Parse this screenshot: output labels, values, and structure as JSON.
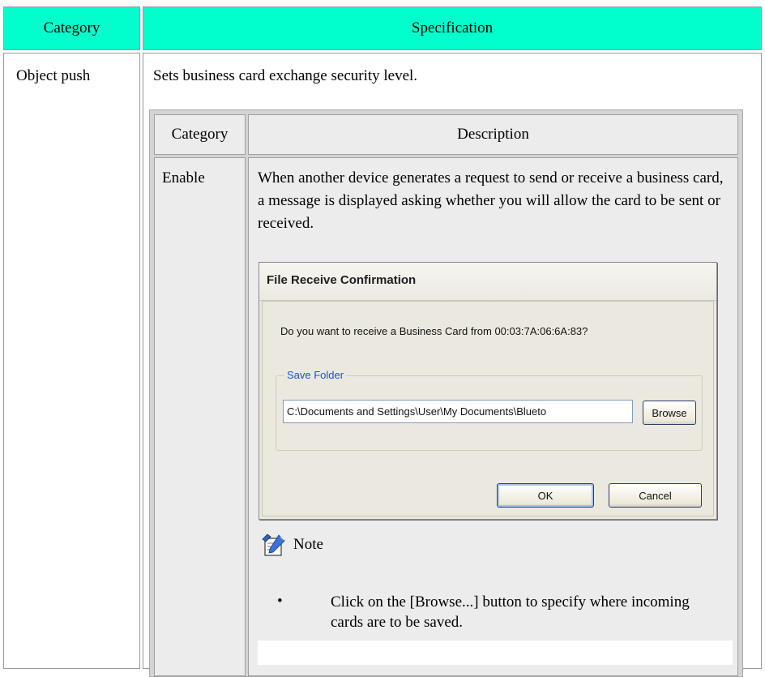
{
  "outer_table": {
    "header_category": "Category",
    "header_specification": "Specification",
    "row_category": "Object push",
    "row_intro": "Sets business card exchange security level."
  },
  "inner_table": {
    "header_category": "Category",
    "header_description": "Description",
    "row_category": "Enable",
    "row_description": "When another device generates a request to send or receive a business card, a message is displayed asking whether you will allow the card to be sent or received."
  },
  "dialog": {
    "title": "File Receive Confirmation",
    "question": "Do you want to receive a Business Card from 00:03:7A:06:6A:83?",
    "group_label": "Save Folder",
    "path_value": "C:\\Documents and Settings\\User\\My Documents\\Blueto",
    "browse_label": "Browse",
    "ok_label": "OK",
    "cancel_label": "Cancel"
  },
  "note": {
    "icon": "note-pencil-icon",
    "label": "Note",
    "bullet": "•",
    "text": "Click on the [Browse...] button to specify where incoming cards are to be saved."
  },
  "colors": {
    "header_accent": "#00ffcc",
    "inner_cell": "#ececec",
    "dialog_face": "#ece9d8",
    "group_label": "#1a4fd6"
  }
}
